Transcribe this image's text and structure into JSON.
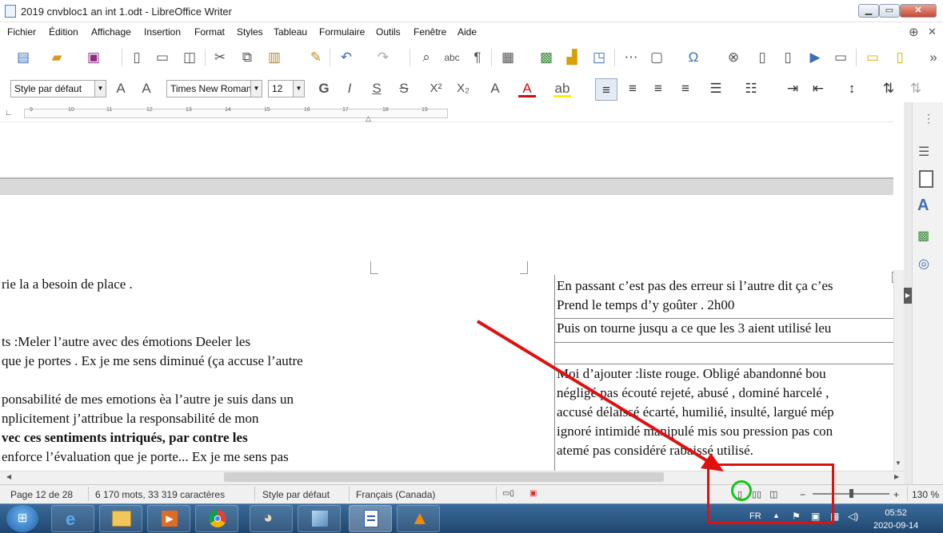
{
  "window": {
    "title": "2019 cnvbloc1 an int 1.odt - LibreOffice Writer",
    "min": "▁",
    "max": "▭",
    "close": "✕"
  },
  "menu": [
    "Fichier",
    "Édition",
    "Affichage",
    "Insertion",
    "Format",
    "Styles",
    "Tableau",
    "Formulaire",
    "Outils",
    "Fenêtre",
    "Aide"
  ],
  "formatting": {
    "paragraph_style": "Style par défaut",
    "font_name": "Times New Roman",
    "font_size": "12"
  },
  "ruler": {
    "ticks": [
      "9",
      "10",
      "11",
      "12",
      "13",
      "14",
      "15",
      "16",
      "17",
      "18",
      "19"
    ]
  },
  "document": {
    "left_lines": [
      "rie la a besoin de place .",
      "",
      "ts :Meler l’autre avec des émotions Deeler les",
      "que je portes . Ex je me sens diminué (ça accuse l’autre",
      "",
      "ponsabilité de mes emotions èa l’autre je suis dans un",
      "nplicitement j’attribue la responsabilité de mon",
      "vec ces sentiments intriqués, par contre les",
      "enforce l’évaluation que je porte... Ex je me sens pas"
    ],
    "right_lines": [
      "En passant c’est pas des erreur si l’autre dit ça c’es",
      "Prend le temps d’y goûter . 2h00",
      "Puis on tourne jusqu a ce que les 3 aient utilisé leu",
      "Moi d’ajouter :liste rouge.  Obligé abandonné bou",
      "négligé pas écouté rejeté, abusé , dominé harcelé ,",
      "accusé délaissé écarté, humilié, insulté, largué mép",
      "ignoré intimidé manipulé mis sou pression pas con",
      "atemé pas considéré rabaissé  utilisé."
    ]
  },
  "status": {
    "page": "Page 12 de 28",
    "words": "6 170 mots, 33 319 caractères",
    "style": "Style par défaut",
    "language": "Français (Canada)",
    "zoom": "130 %",
    "zoom_minus": "−",
    "zoom_plus": "+"
  },
  "taskbar": {
    "lang": "FR",
    "time": "05:52",
    "date": "2020-09-14"
  }
}
